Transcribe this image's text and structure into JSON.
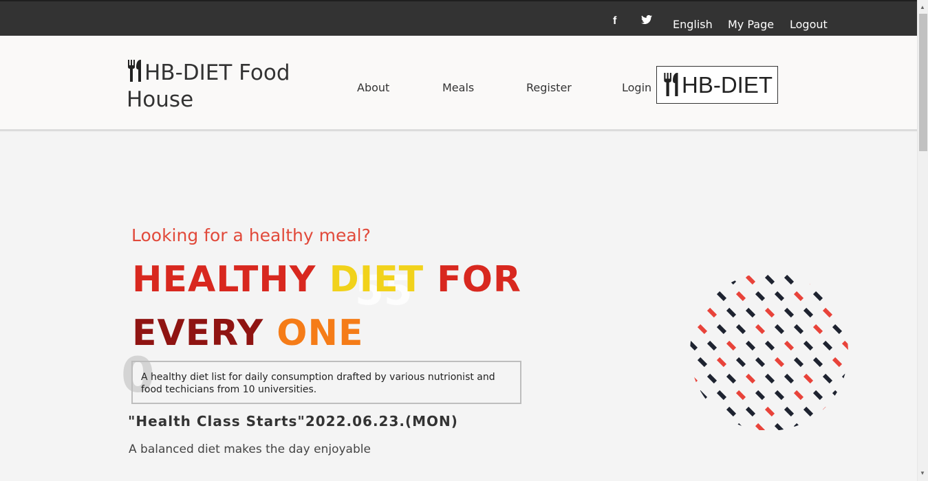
{
  "topbar": {
    "icons": [
      "facebook-icon",
      "twitter-icon"
    ],
    "links": [
      "English",
      "My Page",
      "Logout"
    ]
  },
  "header": {
    "brand": "HB-DIET Food House",
    "nav": [
      "About",
      "Meals",
      "Register",
      "Login"
    ],
    "logo_text": "HB-DIET"
  },
  "hero": {
    "eyebrow": "Looking for a healthy meal?",
    "headline_line1_a": "HEALTHY ",
    "headline_line1_b": "DIET ",
    "headline_line1_c": "FOR",
    "headline_line2_a": "EVERY ",
    "headline_line2_b": "ONE",
    "description": "A healthy diet list for daily consumption drafted by various nutrionist and food techicians from 10 universities.",
    "class_line": "\"Health Class Starts\"2022.06.23.(MON)",
    "tagline": "A balanced diet makes the day enjoyable"
  },
  "colors": {
    "topbar": "#333333",
    "accent_red": "#e14a3b",
    "headline_red": "#d8281f",
    "headline_dark_red": "#8f1412",
    "headline_yellow": "#f1d21b",
    "headline_orange": "#f57c18"
  }
}
